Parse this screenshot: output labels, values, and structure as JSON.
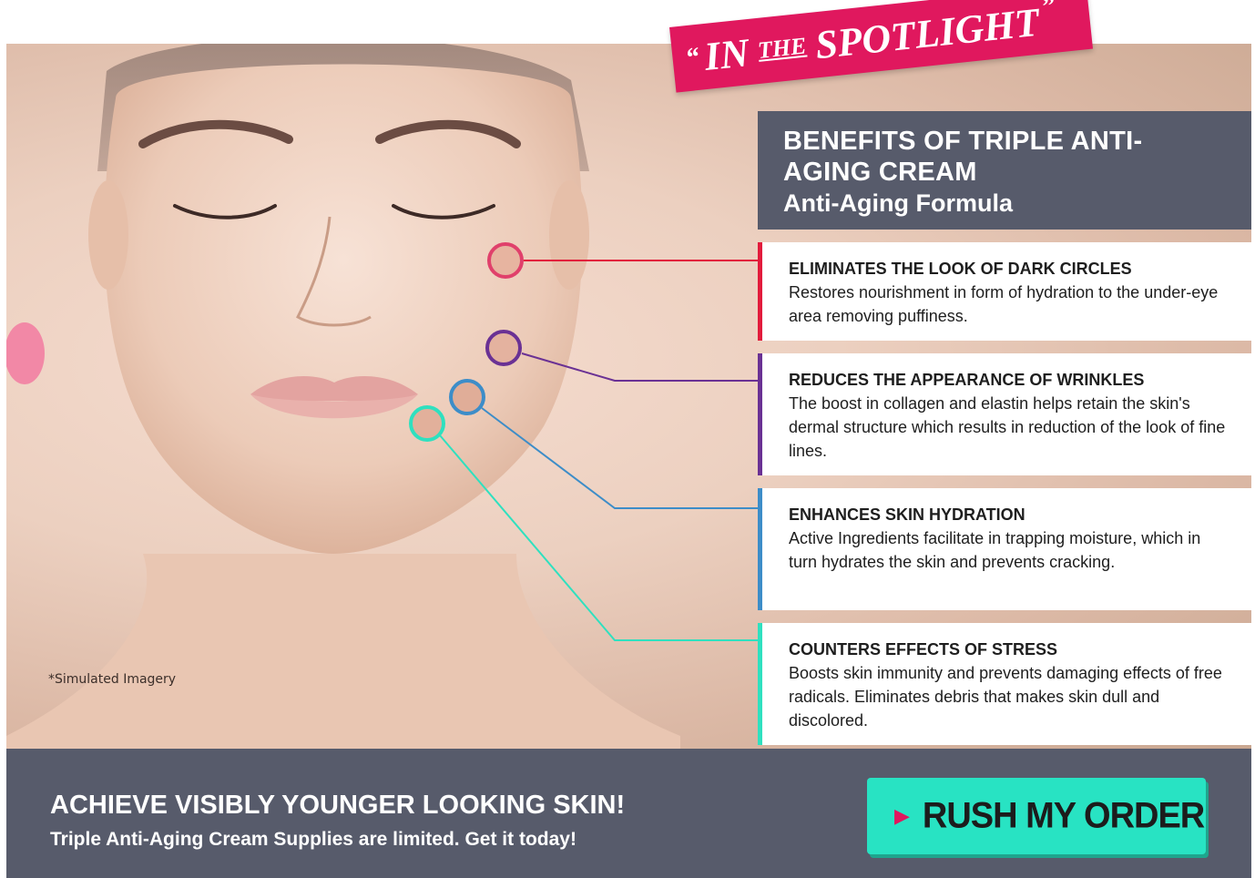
{
  "spotlight": {
    "open_quote": "“",
    "word1": "IN",
    "word2": "THE",
    "word3": "SPOTLIGHT",
    "close_quote": "”"
  },
  "header": {
    "title": "BENEFITS OF TRIPLE ANTI-AGING CREAM",
    "subtitle": "Anti-Aging Formula"
  },
  "hero": {
    "disclaimer": "*Simulated Imagery"
  },
  "benefits": [
    {
      "title": "ELIMINATES THE LOOK OF DARK CIRCLES",
      "description": "Restores nourishment in form of hydration to the under-eye area removing puffiness.",
      "color": "#e21b3c"
    },
    {
      "title": "REDUCES THE APPEARANCE OF WRINKLES",
      "description": "The boost in collagen and elastin helps retain the skin's dermal structure which results in reduction of the look of fine lines.",
      "color": "#6a3194"
    },
    {
      "title": "ENHANCES SKIN HYDRATION",
      "description": "Active Ingredients facilitate in trapping moisture, which in turn hydrates the skin and prevents cracking.",
      "color": "#3d8dc8"
    },
    {
      "title": "COUNTERS EFFECTS OF STRESS",
      "description": "Boosts skin immunity and prevents damaging effects of free radicals. Eliminates debris that makes skin dull and discolored.",
      "color": "#2fe0bf"
    }
  ],
  "footer": {
    "headline": "ACHIEVE VISIBLY YOUNGER LOOKING SKIN!",
    "subline": "Triple Anti-Aging Cream Supplies are limited. Get it today!",
    "cta_label": "RUSH MY ORDER",
    "cta_icon": "play-arrow-icon"
  },
  "colors": {
    "accent_pink": "#e0185e",
    "panel_gray": "#575b6b",
    "cta_teal": "#28e3c3"
  }
}
